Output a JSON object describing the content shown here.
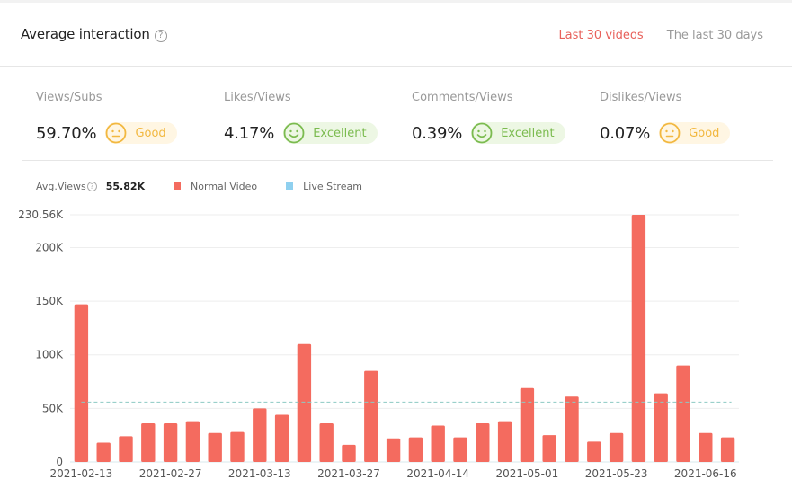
{
  "header": {
    "title": "Average interaction",
    "help_icon": "question-circle-icon",
    "tabs": [
      {
        "label": "Last 30 videos",
        "active": true
      },
      {
        "label": "The last 30 days",
        "active": false
      }
    ]
  },
  "metrics": [
    {
      "label": "Views/Subs",
      "value": "59.70%",
      "rating": "Good",
      "icon": "neutral-face-icon"
    },
    {
      "label": "Likes/Views",
      "value": "4.17%",
      "rating": "Excellent",
      "icon": "smile-face-icon"
    },
    {
      "label": "Comments/Views",
      "value": "0.39%",
      "rating": "Excellent",
      "icon": "smile-face-icon"
    },
    {
      "label": "Dislikes/Views",
      "value": "0.07%",
      "rating": "Good",
      "icon": "neutral-face-icon"
    }
  ],
  "colors": {
    "accent": "#e8605a",
    "bar": "#f46b5f",
    "live": "#8fd0ef",
    "avg_line": "#8cc9c3",
    "good": "#f2b840",
    "excellent": "#7bbb4f"
  },
  "legend": {
    "avg_label": "Avg.Views",
    "avg_value": "55.82K",
    "series": [
      {
        "name": "Normal Video",
        "color": "#f46b5f"
      },
      {
        "name": "Live Stream",
        "color": "#8fd0ef"
      }
    ]
  },
  "chart_data": {
    "type": "bar",
    "title": "",
    "xlabel": "",
    "ylabel": "",
    "ylim": [
      0,
      230560
    ],
    "y_ticks": [
      {
        "value": 0,
        "label": "0"
      },
      {
        "value": 50000,
        "label": "50K"
      },
      {
        "value": 100000,
        "label": "100K"
      },
      {
        "value": 150000,
        "label": "150K"
      },
      {
        "value": 200000,
        "label": "200K"
      },
      {
        "value": 230560,
        "label": "230.56K"
      }
    ],
    "x_tick_labels": [
      {
        "index": 0,
        "label": "2021-02-13"
      },
      {
        "index": 4,
        "label": "2021-02-27"
      },
      {
        "index": 8,
        "label": "2021-03-13"
      },
      {
        "index": 12,
        "label": "2021-03-27"
      },
      {
        "index": 16,
        "label": "2021-04-14"
      },
      {
        "index": 20,
        "label": "2021-05-01"
      },
      {
        "index": 24,
        "label": "2021-05-23"
      },
      {
        "index": 28,
        "label": "2021-06-16"
      }
    ],
    "grid": true,
    "average_line": 55820,
    "series": [
      {
        "name": "Normal Video",
        "values": [
          147000,
          18000,
          24000,
          36000,
          36000,
          38000,
          27000,
          28000,
          50000,
          44000,
          110000,
          36000,
          16000,
          85000,
          22000,
          23000,
          34000,
          23000,
          36000,
          38000,
          69000,
          25000,
          61000,
          19000,
          27000,
          230560,
          64000,
          90000,
          27000,
          23000
        ]
      },
      {
        "name": "Live Stream",
        "values": []
      }
    ]
  }
}
